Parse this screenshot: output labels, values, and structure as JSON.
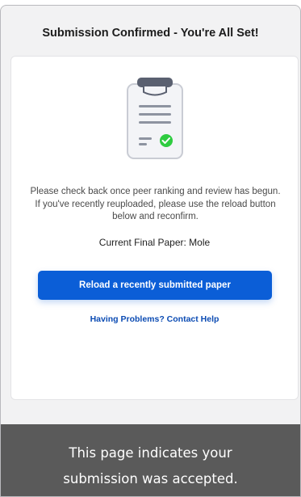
{
  "header": {
    "title": "Submission Confirmed - You're All Set!"
  },
  "card": {
    "illustration_icon": "clipboard-check-icon",
    "message": "Please check back once peer ranking and review has begun. If you've recently reuploaded, please use the reload button below and reconfirm.",
    "current_paper": "Current Final Paper: Mole",
    "reload_button_label": "Reload a recently submitted paper",
    "help_link_label": "Having Problems? Contact Help"
  },
  "caption": {
    "line1": "This page indicates your",
    "line2": "submission was accepted."
  },
  "colors": {
    "accent": "#0b5ed7",
    "link": "#0b4bb3",
    "success": "#2ecc40",
    "caption_bg": "#5a5a5a"
  }
}
